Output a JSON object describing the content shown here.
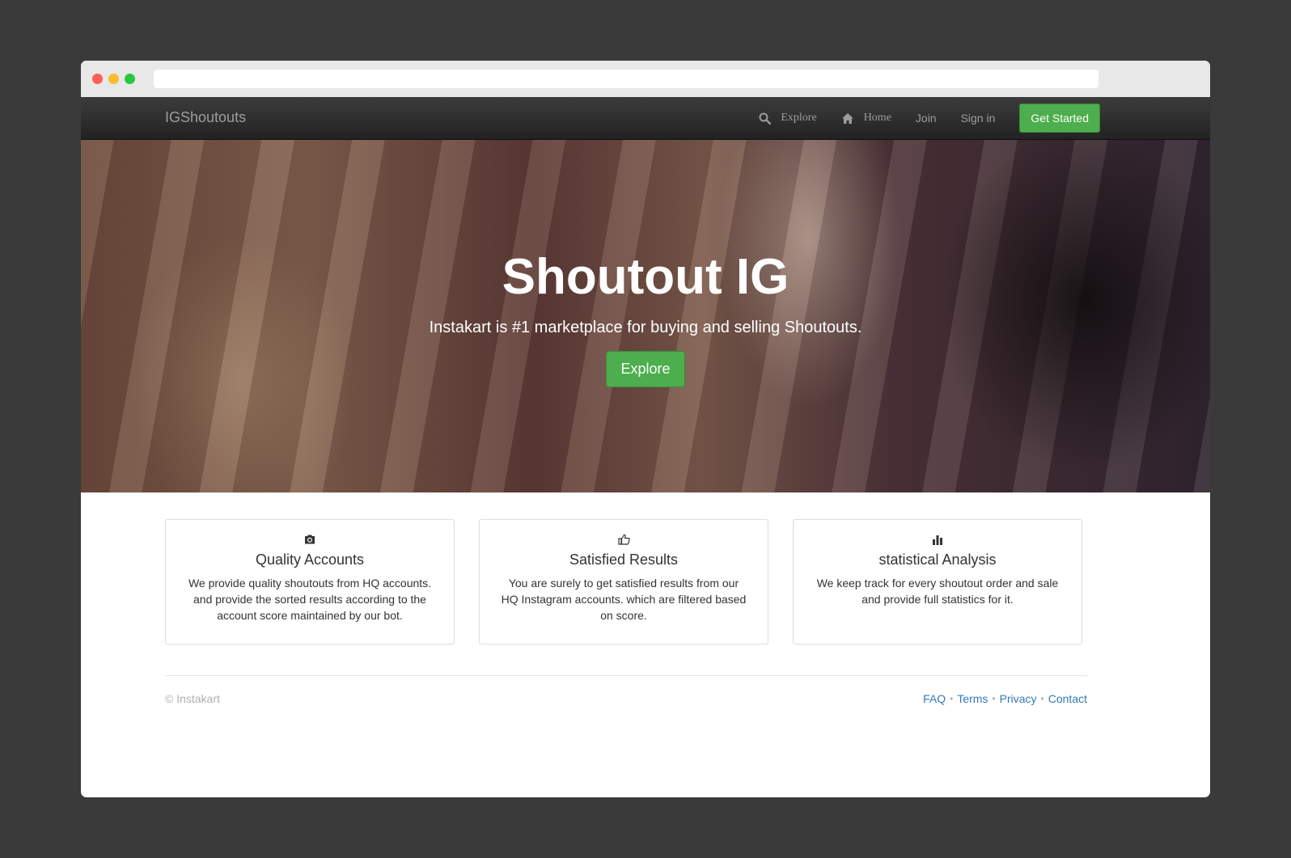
{
  "brand": "IGShoutouts",
  "nav": {
    "explore": "Explore",
    "home": "Home",
    "join": "Join",
    "sign_in": "Sign in",
    "get_started": "Get Started"
  },
  "hero": {
    "title": "Shoutout IG",
    "subtitle": "Instakart is #1 marketplace for buying and selling Shoutouts.",
    "button": "Explore"
  },
  "features": [
    {
      "icon": "camera-icon",
      "title": "Quality Accounts",
      "text": "We provide quality shoutouts from HQ accounts. and provide the sorted results according to the account score maintained by our bot."
    },
    {
      "icon": "thumbs-up-icon",
      "title": "Satisfied Results",
      "text": "You are surely to get satisfied results from our HQ Instagram accounts. which are filtered based on score."
    },
    {
      "icon": "stats-icon",
      "title": "statistical Analysis",
      "text": "We keep track for every shoutout order and sale and provide full statistics for it."
    }
  ],
  "footer": {
    "copyright": "© Instakart",
    "links": [
      "FAQ",
      "Terms",
      "Privacy",
      "Contact"
    ],
    "separator": "•"
  },
  "colors": {
    "background": "#3a3a3a",
    "accent_green": "#4cae4c",
    "link_blue": "#337ab7"
  }
}
